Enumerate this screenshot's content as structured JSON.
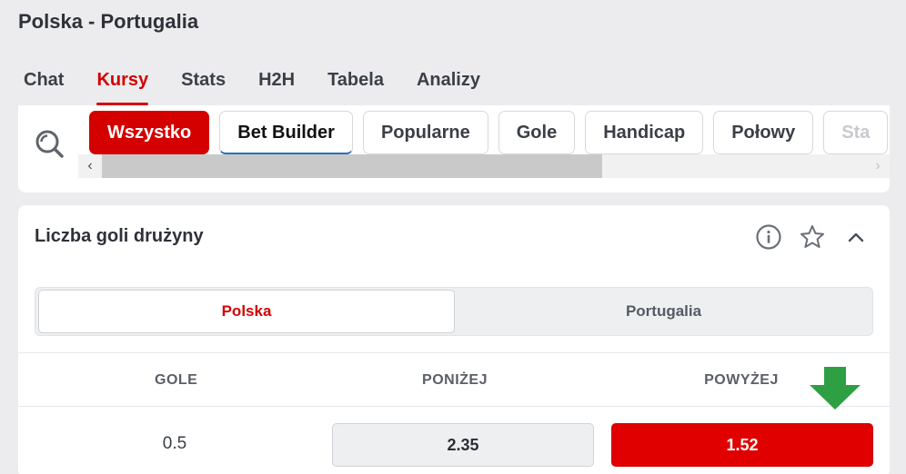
{
  "match": {
    "title": "Polska - Portugalia"
  },
  "tabs": [
    {
      "label": "Chat"
    },
    {
      "label": "Kursy",
      "active": true
    },
    {
      "label": "Stats"
    },
    {
      "label": "H2H"
    },
    {
      "label": "Tabela"
    },
    {
      "label": "Analizy"
    }
  ],
  "filters": {
    "chips": [
      {
        "label": "Wszystko",
        "active": true
      },
      {
        "label": "Bet Builder"
      },
      {
        "label": "Popularne"
      },
      {
        "label": "Gole"
      },
      {
        "label": "Handicap"
      },
      {
        "label": "Połowy"
      },
      {
        "label": "Sta"
      }
    ],
    "scroll_left": "‹",
    "scroll_right": "›"
  },
  "market": {
    "title": "Liczba goli drużyny",
    "teams": {
      "selected": "Polska",
      "other": "Portugalia"
    },
    "columns": {
      "goals": "GOLE",
      "under": "PONIŻEJ",
      "over": "POWYŻEJ"
    },
    "rows": [
      {
        "goals": "0.5",
        "under": "2.35",
        "over": "1.52"
      }
    ]
  },
  "colors": {
    "accent": "#d40000",
    "highlight_arrow": "#2ea043"
  },
  "icons": [
    "search-icon",
    "info-icon",
    "star-icon",
    "chevron-up-icon",
    "arrow-down-icon"
  ]
}
